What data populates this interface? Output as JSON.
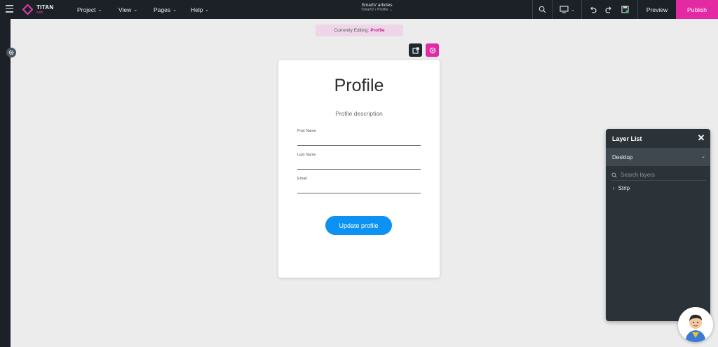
{
  "topbar": {
    "logo": {
      "title": "TITAN",
      "subtitle": "web"
    },
    "menus": [
      {
        "label": "Project"
      },
      {
        "label": "View"
      },
      {
        "label": "Pages"
      },
      {
        "label": "Help"
      }
    ],
    "doc_title": "SmartV articles",
    "doc_path": "SmartV / Profile",
    "preview_label": "Preview",
    "publish_label": "Publish",
    "icons": [
      "menu-icon",
      "search-icon",
      "desktop-icon",
      "undo-icon",
      "redo-icon",
      "save-icon"
    ]
  },
  "editing": {
    "prefix": "Currently Editing:",
    "page": "Profile"
  },
  "card": {
    "title": "Profile",
    "description": "Profile description",
    "fields": [
      {
        "label": "First Name",
        "value": ""
      },
      {
        "label": "Last Name",
        "value": ""
      },
      {
        "label": "Email",
        "value": ""
      }
    ],
    "button_label": "Update profile"
  },
  "layer_panel": {
    "title": "Layer List",
    "device": "Desktop",
    "search_placeholder": "Search layers",
    "items": [
      {
        "label": "Strip"
      }
    ]
  },
  "colors": {
    "topbar_bg": "#1b2127",
    "accent_pink": "#e32aa4",
    "button_blue": "#0c92f2",
    "canvas_bg": "#ececec",
    "panel_bg": "#2b3339"
  }
}
